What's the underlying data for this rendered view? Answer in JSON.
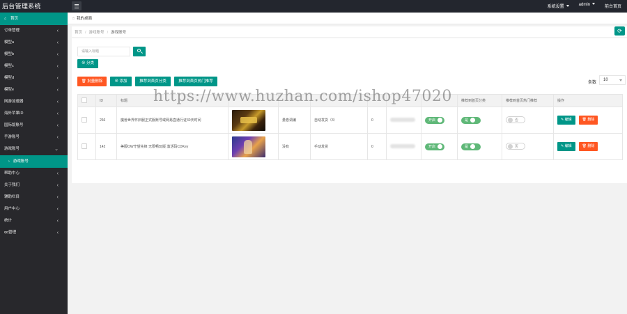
{
  "app": {
    "title": "后台管理系统",
    "top_menu": [
      "系统设置",
      "admin",
      "前台首页"
    ]
  },
  "sidebar": {
    "items": [
      {
        "label": "首页",
        "active": true
      },
      {
        "label": "订单管理"
      },
      {
        "label": "模型a"
      },
      {
        "label": "模型b"
      },
      {
        "label": "模型c"
      },
      {
        "label": "模型d"
      },
      {
        "label": "模型e"
      },
      {
        "label": "网游加速器"
      },
      {
        "label": "海外苹果ID"
      },
      {
        "label": "国际版账号"
      },
      {
        "label": "手游账号"
      },
      {
        "label": "游戏账号",
        "expanded": true
      },
      {
        "label": "游戏账号",
        "sub": true,
        "active": true
      },
      {
        "label": "帮助中心"
      },
      {
        "label": "关于我们"
      },
      {
        "label": "辅助栏目"
      },
      {
        "label": "用户中心"
      },
      {
        "label": "统计"
      },
      {
        "label": "qq管理"
      }
    ]
  },
  "tab": {
    "label": "我的桌面"
  },
  "breadcrumb": [
    "首页",
    "游戏账号",
    "游戏账号"
  ],
  "toolbar": {
    "search_placeholder": "请输入标题",
    "category_label": "分类",
    "batch_delete": "批量删除",
    "add": "添加",
    "recommend_home_category": "推荐到首页分类",
    "recommend_home_hot": "推荐到首页热门推荐",
    "page_size_label": "条数",
    "page_size_value": "10"
  },
  "table": {
    "headers": [
      "",
      "ID",
      "标题",
      "",
      "",
      "",
      "",
      "",
      "",
      "推荐到首页分类",
      "推荐到首页热门推荐",
      "操作"
    ],
    "rows": [
      {
        "id": "266",
        "title": "魔兽世界怀旧服正式服账号或网易直通行证30天时间",
        "image": "world-of-warcraft-cover",
        "col_d": "量卷调编",
        "col_e": "自动发货（3）",
        "col_f": "0",
        "status_on": "开启",
        "category_on": "是",
        "hot": "否"
      },
      {
        "id": "142",
        "title": "美服OW守望先锋 无限畅玩版 激活码CDKey",
        "image": "overwatch-cover",
        "col_d": "没有",
        "col_e": "手动发货",
        "col_f": "0",
        "status_on": "开启",
        "category_on": "是",
        "hot": "否"
      }
    ],
    "edit_label": "编辑",
    "delete_label": "删除"
  },
  "watermark": "https://www.huzhan.com/ishop47020",
  "colors": {
    "accent": "#009688",
    "danger": "#ff5722",
    "sidebar": "#28282c",
    "topbar": "#23262e",
    "switch_on": "#5fb878"
  }
}
